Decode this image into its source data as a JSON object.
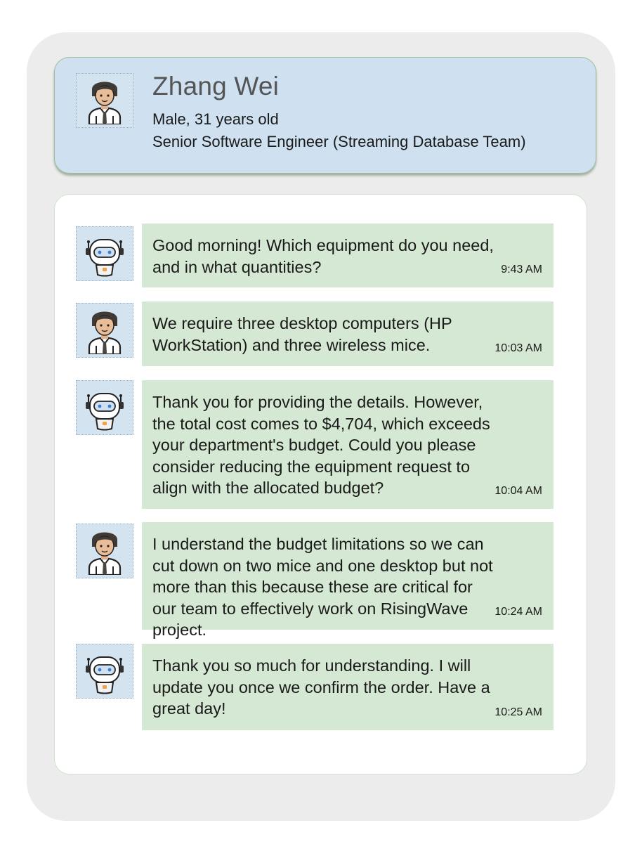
{
  "profile": {
    "name": "Zhang Wei",
    "gender_age": "Male, 31 years old",
    "role": "Senior Software Engineer (Streaming Database Team)",
    "avatar_icon": "man-avatar-icon"
  },
  "messages": [
    {
      "sender": "bot",
      "avatar_icon": "robot-avatar-icon",
      "text": "Good morning! Which equipment do you need, and in what quantities?",
      "time": "9:43 AM"
    },
    {
      "sender": "user",
      "avatar_icon": "man-avatar-icon",
      "text": "We require three desktop computers (HP WorkStation) and three wireless mice.",
      "time": "10:03 AM"
    },
    {
      "sender": "bot",
      "avatar_icon": "robot-avatar-icon",
      "text": "Thank you for providing the details. However, the total cost comes to $4,704, which exceeds your department's budget. Could you please consider reducing the equipment request to align with the allocated budget?",
      "time": "10:04 AM"
    },
    {
      "sender": "user",
      "avatar_icon": "man-avatar-icon",
      "text": "I understand the budget limitations so we can cut down on two mice and one desktop but not more than this because these are critical for our team to effectively work on RisingWave project.",
      "time": "10:24 AM"
    },
    {
      "sender": "bot",
      "avatar_icon": "robot-avatar-icon",
      "text": "Thank you so much for understanding. I will update you once we confirm the order. Have a great day!",
      "time": "10:25 AM"
    }
  ],
  "colors": {
    "profile_bg": "#cfe1f0",
    "bubble_bg": "#d5e8d3",
    "outer_bg": "#ececec"
  }
}
